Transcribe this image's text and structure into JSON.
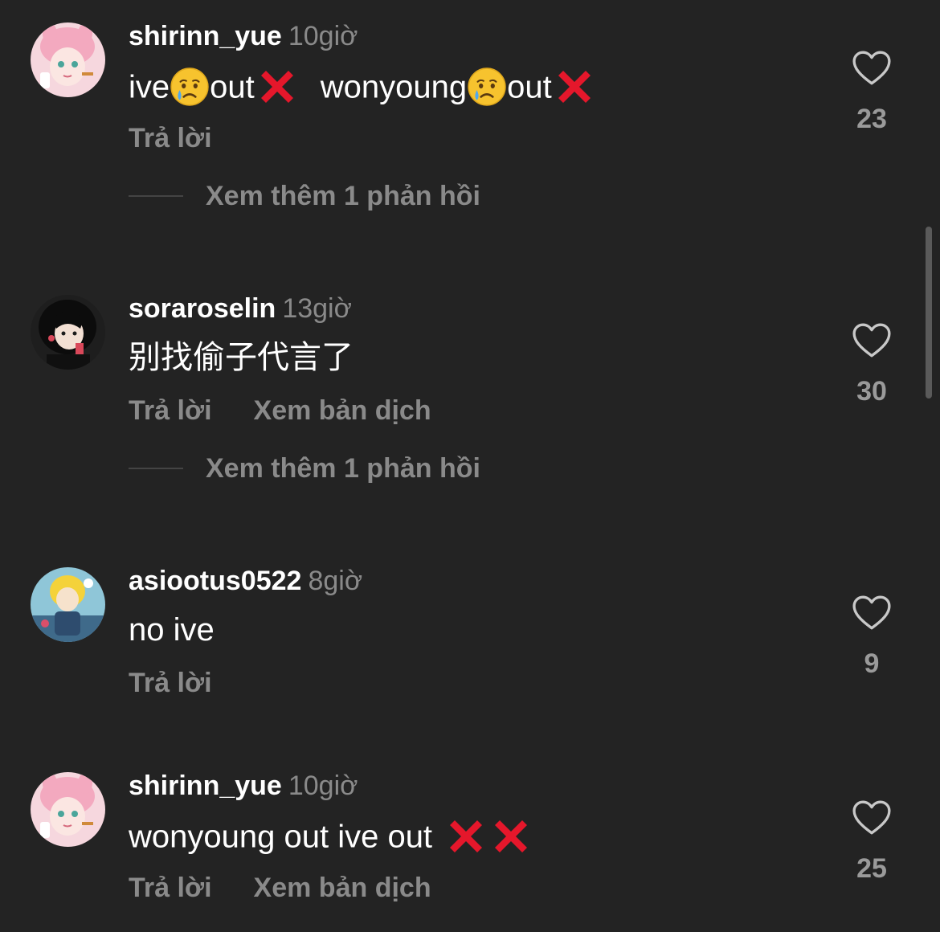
{
  "comments": [
    {
      "username": "shirinn_yue",
      "time": "10giờ",
      "avatar": "pink-bunny-hat-girl-avatar",
      "segments": {
        "s1": "ive",
        "s2": "out",
        "s3": "wonyoung",
        "s4": "out"
      },
      "reply_label": "Trả lời",
      "likes": "23",
      "more_replies": "Xem thêm 1 phản hồi"
    },
    {
      "username": "soraroselin",
      "time": "13giờ",
      "avatar": "dark-hair-anime-girl-avatar",
      "text": "别找偷子代言了",
      "reply_label": "Trả lời",
      "translate_label": "Xem bản dịch",
      "likes": "30",
      "more_replies": "Xem thêm 1 phản hồi"
    },
    {
      "username": "asiootus0522",
      "time": "8giờ",
      "avatar": "blonde-anime-character-avatar",
      "text": "no ive",
      "reply_label": "Trả lời",
      "likes": "9"
    },
    {
      "username": "shirinn_yue",
      "time": "10giờ",
      "avatar": "pink-bunny-hat-girl-avatar",
      "text": "wonyoung out ive out",
      "reply_label": "Trả lời",
      "translate_label": "Xem bản dịch",
      "likes": "25"
    }
  ],
  "icons": {
    "like": "heart-outline-icon",
    "emoji_cry": "crying-face-emoji",
    "emoji_cross": "red-cross-mark-emoji"
  },
  "colors": {
    "background": "#232323",
    "secondary_text": "#8a8a8a",
    "cross_red": "#e5172b",
    "emoji_yellow": "#f7c32e"
  }
}
